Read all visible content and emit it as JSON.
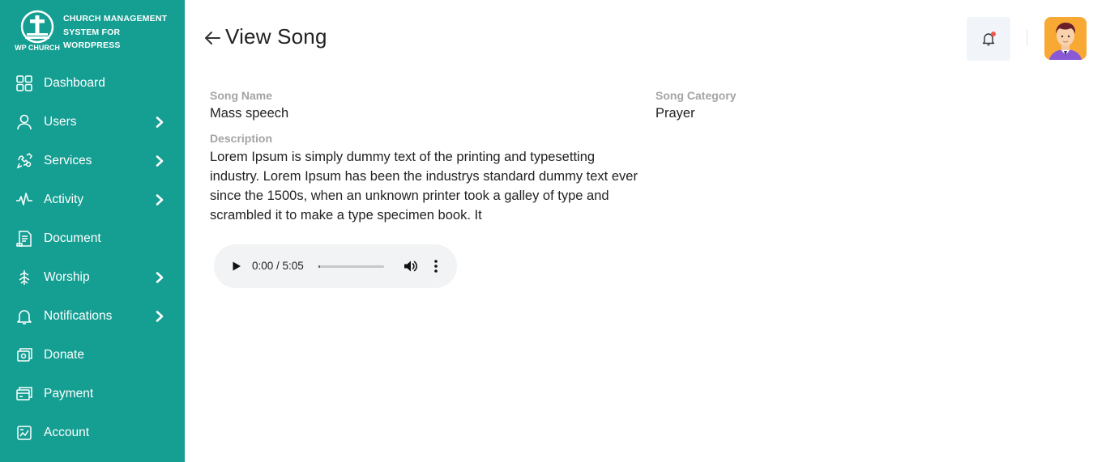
{
  "brand": {
    "logo_text": "WP CHURCH",
    "line1": "CHURCH MANAGEMENT",
    "line2": "SYSTEM FOR",
    "line3": "WORDPRESS"
  },
  "sidebar": {
    "items": [
      {
        "label": "Dashboard",
        "icon": "dashboard-icon",
        "has_submenu": false
      },
      {
        "label": "Users",
        "icon": "user-icon",
        "has_submenu": true
      },
      {
        "label": "Services",
        "icon": "services-icon",
        "has_submenu": true
      },
      {
        "label": "Activity",
        "icon": "activity-icon",
        "has_submenu": true
      },
      {
        "label": "Document",
        "icon": "document-icon",
        "has_submenu": false
      },
      {
        "label": "Worship",
        "icon": "worship-icon",
        "has_submenu": true
      },
      {
        "label": "Notifications",
        "icon": "bell-icon",
        "has_submenu": true
      },
      {
        "label": "Donate",
        "icon": "donate-icon",
        "has_submenu": false
      },
      {
        "label": "Payment",
        "icon": "payment-icon",
        "has_submenu": false
      },
      {
        "label": "Account",
        "icon": "account-icon",
        "has_submenu": false
      }
    ]
  },
  "header": {
    "title": "View Song"
  },
  "song": {
    "name_label": "Song Name",
    "name_value": "Mass speech",
    "category_label": "Song Category",
    "category_value": "Prayer",
    "description_label": "Description",
    "description_value": "Lorem Ipsum is simply dummy text of the printing and typesetting industry. Lorem Ipsum has been the industrys standard dummy text ever since the 1500s, when an unknown printer took a galley of type and scrambled it to make a type specimen book. It"
  },
  "audio": {
    "time": "0:00 / 5:05",
    "progress": 0.0
  },
  "colors": {
    "sidebar_bg": "#159e92",
    "notification_dot": "#f0554b",
    "avatar_bg": "#f8a934"
  }
}
